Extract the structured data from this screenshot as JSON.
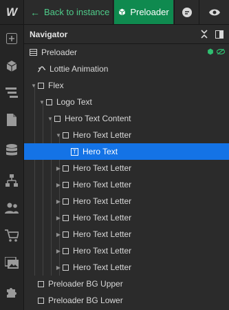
{
  "app": {
    "logo": "W"
  },
  "topbar": {
    "back_arrow": "←",
    "back_label": "Back to instance",
    "component_label": "Preloader"
  },
  "navigator": {
    "title": "Navigator",
    "items": [
      {
        "label": "Preloader",
        "depth": 0,
        "icon": "component-layout-icon"
      },
      {
        "label": "Lottie Animation",
        "depth": 1,
        "icon": "lottie-icon"
      },
      {
        "label": "Flex",
        "depth": 0,
        "icon": "box-icon",
        "expanded": true
      },
      {
        "label": "Logo Text",
        "depth": 1,
        "icon": "box-icon",
        "expanded": true
      },
      {
        "label": "Hero Text Content",
        "depth": 2,
        "icon": "box-icon",
        "expanded": true
      },
      {
        "label": "Hero Text Letter",
        "depth": 3,
        "icon": "box-icon",
        "expanded": true
      },
      {
        "label": "Hero Text",
        "depth": 4,
        "icon": "text-icon",
        "selected": true
      },
      {
        "label": "Hero Text Letter",
        "depth": 3,
        "icon": "box-icon",
        "expanded": false
      },
      {
        "label": "Hero Text Letter",
        "depth": 3,
        "icon": "box-icon",
        "expanded": false
      },
      {
        "label": "Hero Text Letter",
        "depth": 3,
        "icon": "box-icon",
        "expanded": false
      },
      {
        "label": "Hero Text Letter",
        "depth": 3,
        "icon": "box-icon",
        "expanded": false
      },
      {
        "label": "Hero Text Letter",
        "depth": 3,
        "icon": "box-icon",
        "expanded": false
      },
      {
        "label": "Hero Text Letter",
        "depth": 3,
        "icon": "box-icon",
        "expanded": false
      },
      {
        "label": "Hero Text Letter",
        "depth": 3,
        "icon": "box-icon",
        "expanded": false
      },
      {
        "label": "Preloader BG Upper",
        "depth": 0,
        "icon": "box-icon"
      },
      {
        "label": "Preloader BG Lower",
        "depth": 0,
        "icon": "box-icon"
      }
    ]
  },
  "colors": {
    "accent_green": "#0f8a4f",
    "link_green": "#4fcc8a",
    "selection_blue": "#1473e6"
  },
  "rail_icons": [
    "add-icon",
    "components-icon",
    "navigator-icon",
    "pages-icon",
    "cms-icon",
    "logic-icon",
    "users-icon",
    "ecommerce-icon",
    "assets-icon",
    "apps-icon"
  ]
}
